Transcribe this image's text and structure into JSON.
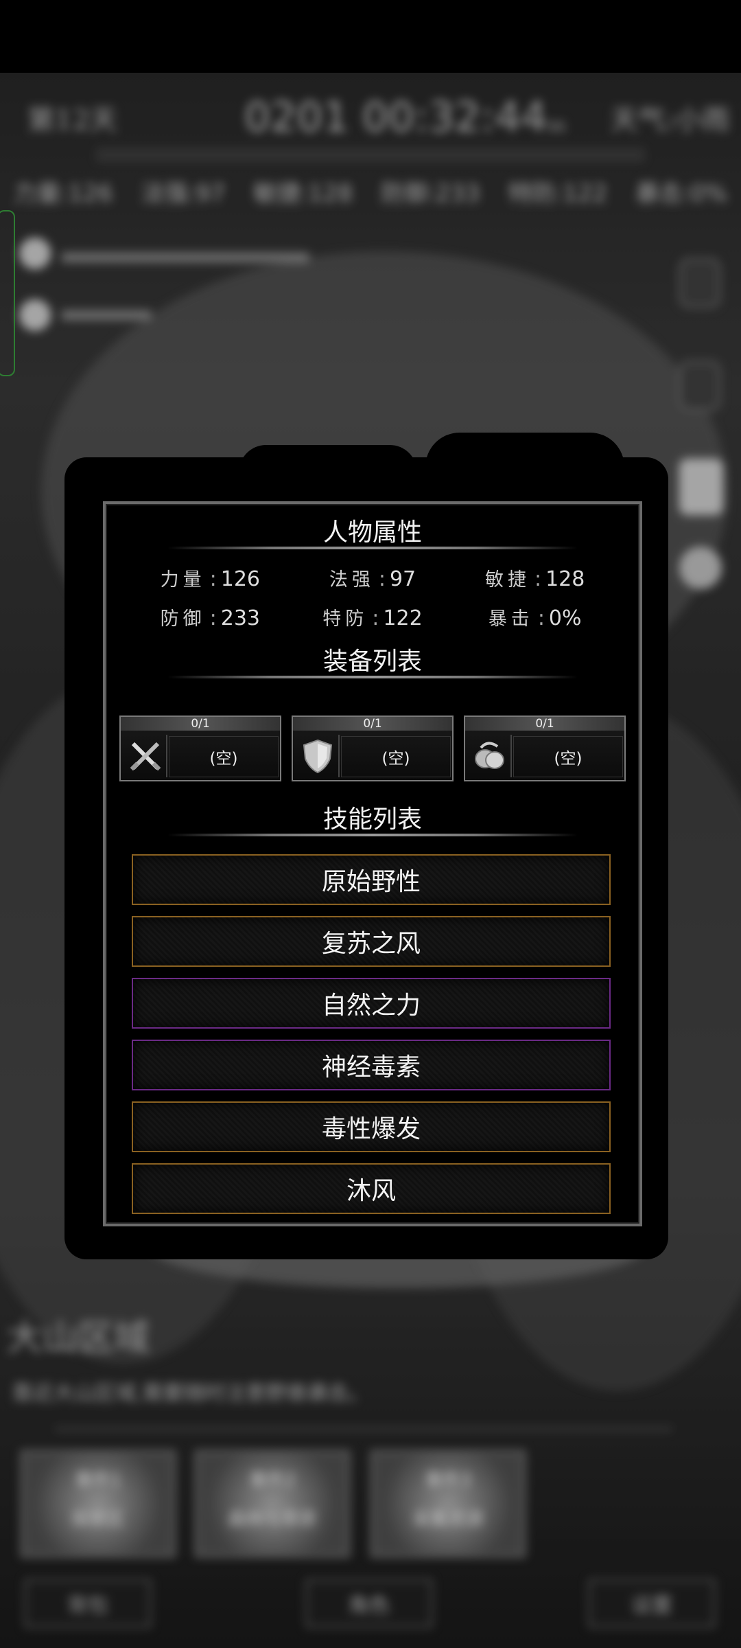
{
  "colors": {
    "skill_orange_border": "#8a6121",
    "skill_purple_border": "#6a2a85",
    "panel_border": "#6b6b6b"
  },
  "background": {
    "day": "第12天",
    "clock": "0201 00:32:44",
    "clock_suffix": "ss",
    "weather": "天气:小雨",
    "stats": [
      "力量:126",
      "法强:97",
      "敏捷:128",
      "防御:233",
      "特防:122",
      "暴击:0%"
    ],
    "area_title": "大山区域",
    "area_desc": "靠近大山区域,需要随时注意野兽袭击。",
    "tiles": [
      {
        "line1": "事件1",
        "line2": "探索区"
      },
      {
        "line1": "事件2",
        "line2": "森林与草原"
      },
      {
        "line1": "事件3",
        "line2": "采集资源"
      }
    ],
    "bottom_buttons": [
      "背包",
      "角色",
      "设置"
    ]
  },
  "panel": {
    "attributes_title": "人物属性",
    "attributes": [
      {
        "key": "力量",
        "value": "126"
      },
      {
        "key": "法强",
        "value": "97"
      },
      {
        "key": "敏捷",
        "value": "128"
      },
      {
        "key": "防御",
        "value": "233"
      },
      {
        "key": "特防",
        "value": "122"
      },
      {
        "key": "暴击",
        "value": "0%"
      }
    ],
    "stat_separator": ":",
    "equipment_title": "装备列表",
    "equipment": [
      {
        "count": "0/1",
        "label": "(空)",
        "icon": "crossed-swords-icon"
      },
      {
        "count": "0/1",
        "label": "(空)",
        "icon": "shield-icon"
      },
      {
        "count": "0/1",
        "label": "(空)",
        "icon": "accessory-icon"
      }
    ],
    "skills_title": "技能列表",
    "skills": [
      {
        "name": "原始野性",
        "rarity": "orange"
      },
      {
        "name": "复苏之风",
        "rarity": "orange"
      },
      {
        "name": "自然之力",
        "rarity": "purple"
      },
      {
        "name": "神经毒素",
        "rarity": "purple"
      },
      {
        "name": "毒性爆发",
        "rarity": "orange"
      },
      {
        "name": "沐风",
        "rarity": "orange"
      }
    ]
  }
}
